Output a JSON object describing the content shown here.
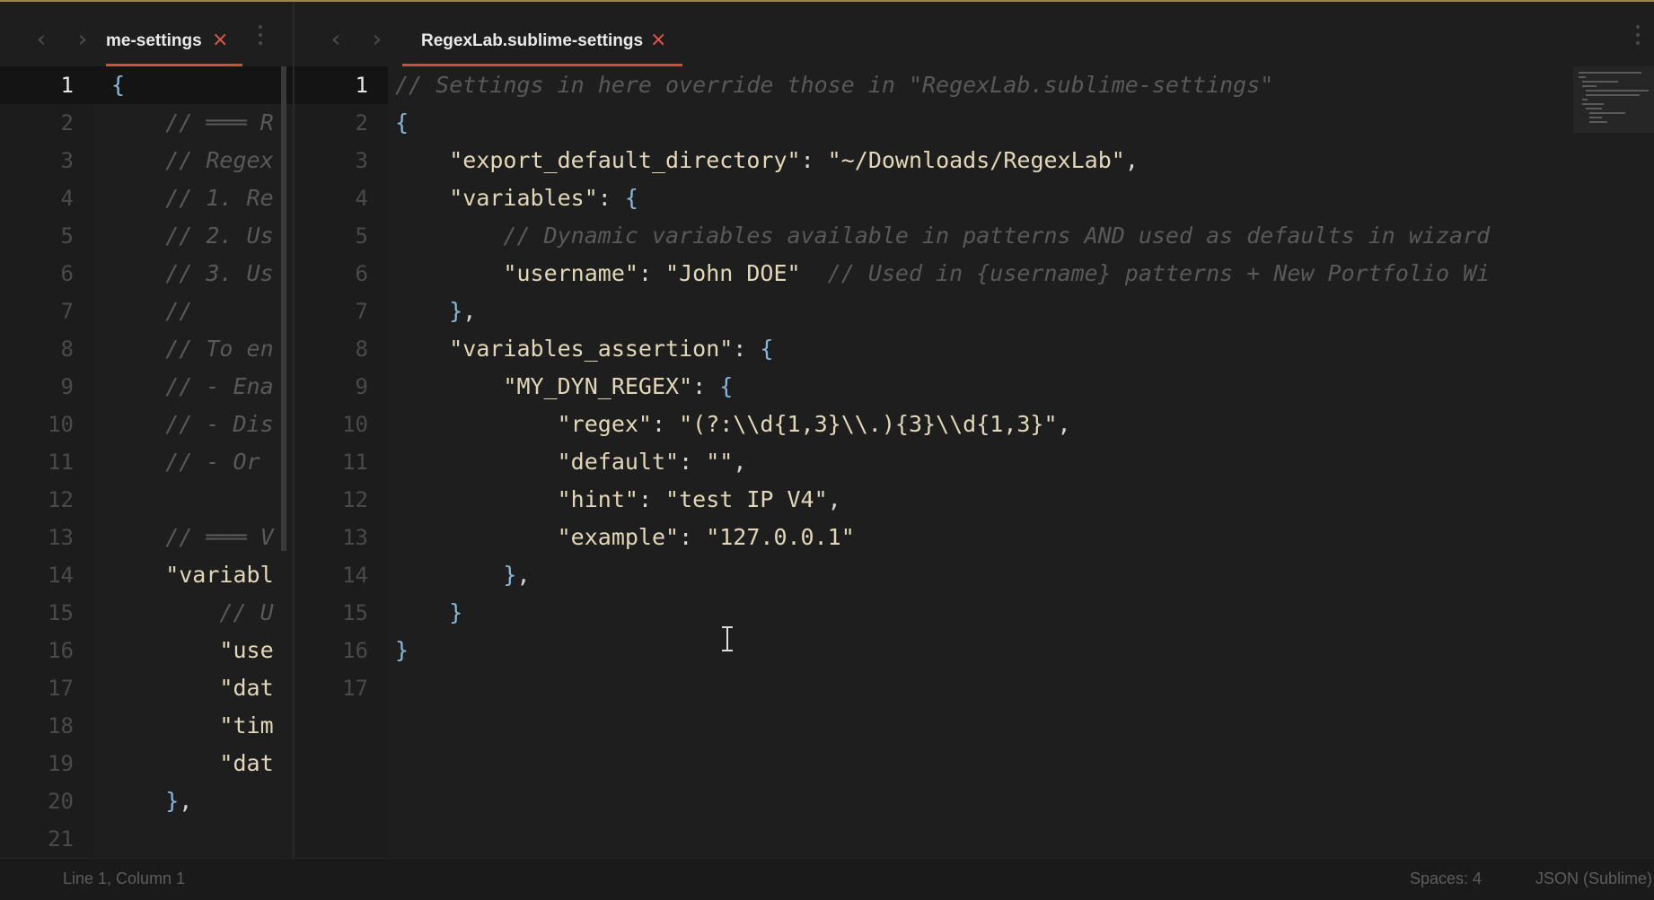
{
  "left_pane": {
    "tab_label": "me-settings",
    "close_glyph": "×",
    "nav_back_glyph": "‹",
    "nav_forward_glyph": "›",
    "line_numbers": [
      "1",
      "2",
      "3",
      "4",
      "5",
      "6",
      "7",
      "8",
      "9",
      "10",
      "11",
      "12",
      "13",
      "14",
      "15",
      "16",
      "17",
      "18",
      "19",
      "20",
      "21"
    ],
    "lines": [
      [
        {
          "t": "{",
          "c": "brace"
        }
      ],
      [
        {
          "t": "    // ═══ R",
          "c": "comment"
        }
      ],
      [
        {
          "t": "    // Regex",
          "c": "comment"
        }
      ],
      [
        {
          "t": "    // 1. Re",
          "c": "comment"
        }
      ],
      [
        {
          "t": "    // 2. Us",
          "c": "comment"
        }
      ],
      [
        {
          "t": "    // 3. Us",
          "c": "comment"
        }
      ],
      [
        {
          "t": "    //",
          "c": "comment"
        }
      ],
      [
        {
          "t": "    // To en",
          "c": "comment"
        }
      ],
      [
        {
          "t": "    // - Ena",
          "c": "comment"
        }
      ],
      [
        {
          "t": "    // - Dis",
          "c": "comment"
        }
      ],
      [
        {
          "t": "    // - Or",
          "c": "comment"
        }
      ],
      [],
      [
        {
          "t": "    // ═══ V",
          "c": "comment"
        }
      ],
      [
        {
          "t": "    \"variabl",
          "c": "key"
        }
      ],
      [
        {
          "t": "        // U",
          "c": "comment"
        }
      ],
      [
        {
          "t": "        \"use",
          "c": "key"
        }
      ],
      [
        {
          "t": "        \"dat",
          "c": "key"
        }
      ],
      [
        {
          "t": "        \"tim",
          "c": "key"
        }
      ],
      [
        {
          "t": "        \"dat",
          "c": "key"
        }
      ],
      [
        {
          "t": "    }",
          "c": "brace"
        },
        {
          "t": ",",
          "c": "punct"
        }
      ],
      []
    ]
  },
  "right_pane": {
    "tab_label": "RegexLab.sublime-settings",
    "close_glyph": "×",
    "nav_back_glyph": "‹",
    "nav_forward_glyph": "›",
    "line_numbers": [
      "1",
      "2",
      "3",
      "4",
      "5",
      "6",
      "7",
      "8",
      "9",
      "10",
      "11",
      "12",
      "13",
      "14",
      "15",
      "16",
      "17"
    ],
    "lines": [
      [
        {
          "t": "// Settings in here override those in \"RegexLab.sublime-settings\"",
          "c": "comment"
        }
      ],
      [
        {
          "t": "{",
          "c": "brace"
        }
      ],
      [
        {
          "t": "    ",
          "c": "punct"
        },
        {
          "t": "\"export_default_directory\"",
          "c": "key"
        },
        {
          "t": ": ",
          "c": "punct"
        },
        {
          "t": "\"~/Downloads/RegexLab\"",
          "c": "str"
        },
        {
          "t": ",",
          "c": "punct"
        }
      ],
      [
        {
          "t": "    ",
          "c": "punct"
        },
        {
          "t": "\"variables\"",
          "c": "key"
        },
        {
          "t": ": ",
          "c": "punct"
        },
        {
          "t": "{",
          "c": "brace"
        }
      ],
      [
        {
          "t": "        // Dynamic variables available in patterns AND used as defaults in wizard",
          "c": "comment"
        }
      ],
      [
        {
          "t": "        ",
          "c": "punct"
        },
        {
          "t": "\"username\"",
          "c": "key"
        },
        {
          "t": ": ",
          "c": "punct"
        },
        {
          "t": "\"John DOE\"",
          "c": "str"
        },
        {
          "t": "  // Used in {username} patterns + New Portfolio Wi",
          "c": "comment"
        }
      ],
      [
        {
          "t": "    ",
          "c": "punct"
        },
        {
          "t": "}",
          "c": "brace"
        },
        {
          "t": ",",
          "c": "punct"
        }
      ],
      [
        {
          "t": "    ",
          "c": "punct"
        },
        {
          "t": "\"variables_assertion\"",
          "c": "key"
        },
        {
          "t": ": ",
          "c": "punct"
        },
        {
          "t": "{",
          "c": "brace"
        }
      ],
      [
        {
          "t": "        ",
          "c": "punct"
        },
        {
          "t": "\"MY_DYN_REGEX\"",
          "c": "key"
        },
        {
          "t": ": ",
          "c": "punct"
        },
        {
          "t": "{",
          "c": "brace"
        }
      ],
      [
        {
          "t": "            ",
          "c": "punct"
        },
        {
          "t": "\"regex\"",
          "c": "key"
        },
        {
          "t": ": ",
          "c": "punct"
        },
        {
          "t": "\"(?:\\\\d{1,3}\\\\.){3}\\\\d{1,3}\"",
          "c": "str"
        },
        {
          "t": ",",
          "c": "punct"
        }
      ],
      [
        {
          "t": "            ",
          "c": "punct"
        },
        {
          "t": "\"default\"",
          "c": "key"
        },
        {
          "t": ": ",
          "c": "punct"
        },
        {
          "t": "\"\"",
          "c": "str"
        },
        {
          "t": ",",
          "c": "punct"
        }
      ],
      [
        {
          "t": "            ",
          "c": "punct"
        },
        {
          "t": "\"hint\"",
          "c": "key"
        },
        {
          "t": ": ",
          "c": "punct"
        },
        {
          "t": "\"test IP V4\"",
          "c": "str"
        },
        {
          "t": ",",
          "c": "punct"
        }
      ],
      [
        {
          "t": "            ",
          "c": "punct"
        },
        {
          "t": "\"example\"",
          "c": "key"
        },
        {
          "t": ": ",
          "c": "punct"
        },
        {
          "t": "\"127.0.0.1\"",
          "c": "str"
        }
      ],
      [
        {
          "t": "        ",
          "c": "punct"
        },
        {
          "t": "}",
          "c": "brace"
        },
        {
          "t": ",",
          "c": "punct"
        }
      ],
      [
        {
          "t": "    ",
          "c": "punct"
        },
        {
          "t": "}",
          "c": "brace"
        }
      ],
      [
        {
          "t": "}",
          "c": "brace"
        }
      ],
      []
    ]
  },
  "statusbar": {
    "position": "Line 1, Column 1",
    "spaces": "Spaces: 4",
    "syntax": "JSON (Sublime)"
  },
  "colors": {
    "background": "#1e1e1e",
    "tab_underline": "#d14f3a",
    "close": "#e55b4b",
    "brace": "#87b8d8",
    "string": "#e2d8b9",
    "comment": "#595959"
  }
}
